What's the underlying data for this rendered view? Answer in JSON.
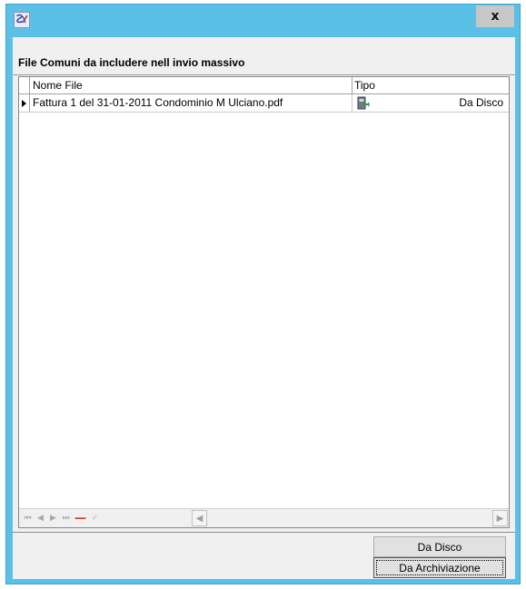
{
  "window": {
    "close_label": "x"
  },
  "group": {
    "title": "File Comuni da includere nell invio massivo"
  },
  "grid": {
    "columns": [
      "Nome File",
      "Tipo"
    ],
    "rows": [
      {
        "name": "Fattura 1 del 31-01-2011  Condominio M Ulciano.pdf",
        "tipo_icon": "disk-import-icon",
        "tipo": "Da Disco"
      }
    ]
  },
  "navigator": {
    "first": "⏮",
    "prev": "◀",
    "next": "▶",
    "last": "⏭",
    "delete": "—",
    "post": "✓",
    "scroll_left": "◀",
    "scroll_right": "▶"
  },
  "buttons": {
    "da_disco": "Da Disco",
    "da_archiviazione": "Da Archiviazione"
  },
  "colors": {
    "title_bar": "#5bc0e6",
    "client_bg": "#f0f0f0",
    "delete_red": "#d23a3a"
  }
}
